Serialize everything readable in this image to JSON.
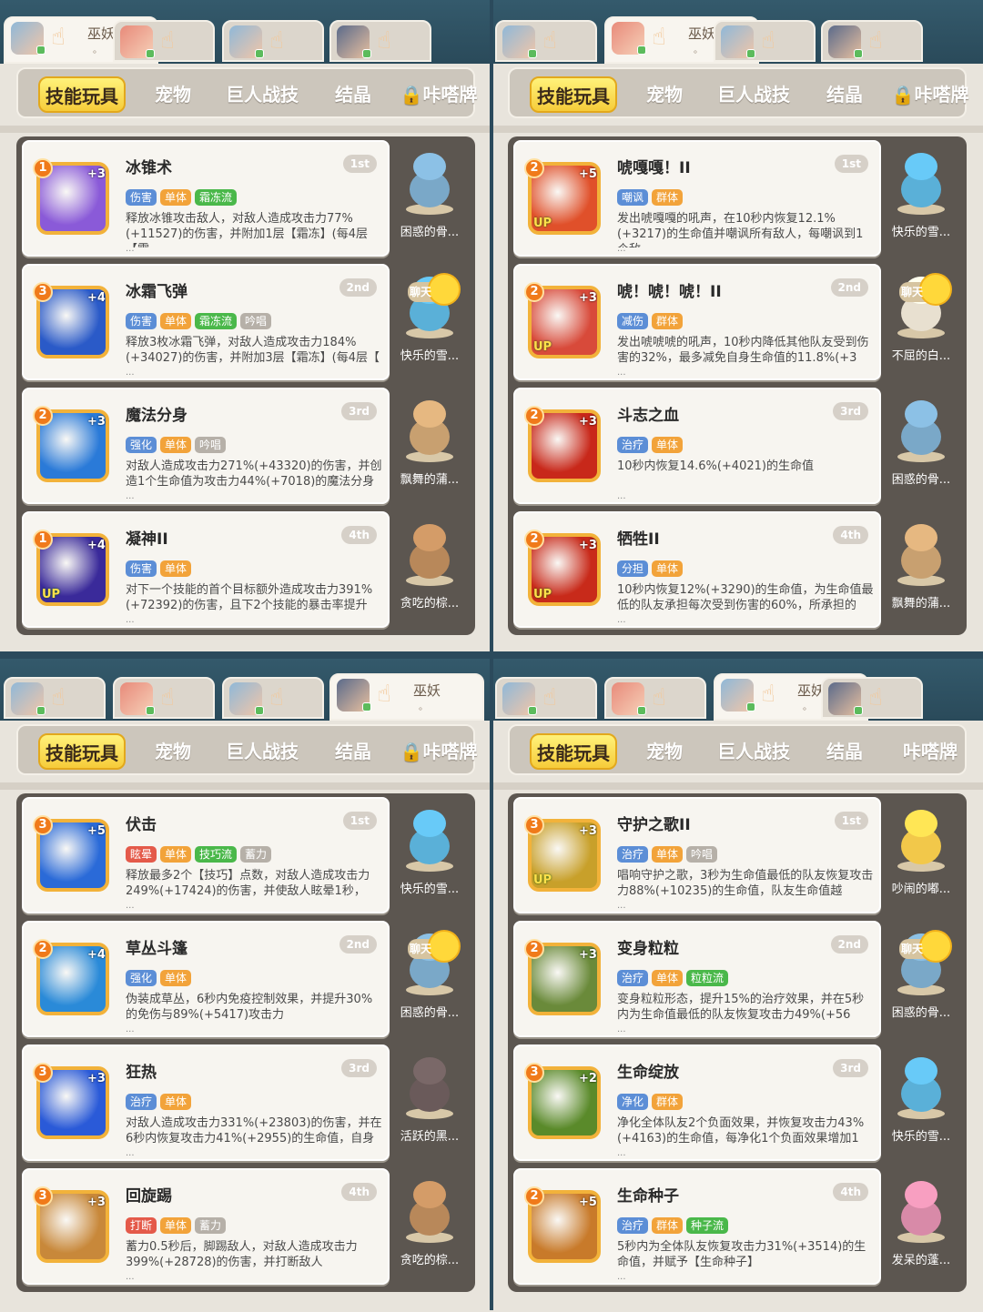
{
  "colors": {
    "tag_red": "#e45a4a",
    "tag_blue": "#5c8ed6",
    "tag_orange": "#f2a33a",
    "tag_green": "#4ab84a",
    "tag_gray": "#b6b0a8",
    "rank_bg": "#d6d0c8",
    "active_tab": "#f6cc3a"
  },
  "panels": [
    {
      "char_tabs": [
        {
          "name": "巫妖",
          "sub": "。",
          "active": true
        },
        {
          "name": "",
          "sub": "",
          "active": false
        },
        {
          "name": "",
          "sub": "",
          "active": false
        },
        {
          "name": "",
          "sub": "",
          "active": false
        }
      ],
      "tabs": [
        {
          "label": "技能玩具",
          "active": true
        },
        {
          "label": "宠物",
          "active": false
        },
        {
          "label": "巨人战技",
          "active": false
        },
        {
          "label": "结晶",
          "active": false
        },
        {
          "label": "🔒咔嗒牌",
          "active": false
        }
      ],
      "skills": [
        {
          "name": "冰锥术",
          "rank": "1st",
          "level": "1",
          "plus": "+3",
          "up": false,
          "icon_color": "#8a5ad8",
          "tags": [
            {
              "text": "伤害",
              "color": "blue"
            },
            {
              "text": "单体",
              "color": "orange"
            },
            {
              "text": "霜冻流",
              "color": "green"
            }
          ],
          "desc": "释放冰锥攻击敌人，对敌人造成攻击力77%(+11527)的伤害，并附加1层【霜冻】(每4层【霜",
          "pet": "困惑的骨...",
          "pet_color": "#7aa8c8",
          "chat": false
        },
        {
          "name": "冰霜飞弹",
          "rank": "2nd",
          "level": "3",
          "plus": "+4",
          "up": false,
          "icon_color": "#2a5ac8",
          "tags": [
            {
              "text": "伤害",
              "color": "blue"
            },
            {
              "text": "单体",
              "color": "orange"
            },
            {
              "text": "霜冻流",
              "color": "green"
            },
            {
              "text": "吟唱",
              "color": "gray"
            }
          ],
          "desc": "释放3枚冰霜飞弹，对敌人造成攻击力184%(+34027)的伤害，并附加3层【霜冻】(每4层【",
          "pet": "快乐的雪...",
          "pet_color": "#5ab0d8",
          "chat": true,
          "chat_label": "聊天"
        },
        {
          "name": "魔法分身",
          "rank": "3rd",
          "level": "2",
          "plus": "+3",
          "up": false,
          "icon_color": "#2a7ad8",
          "tags": [
            {
              "text": "强化",
              "color": "blue"
            },
            {
              "text": "单体",
              "color": "orange"
            },
            {
              "text": "吟唱",
              "color": "gray"
            }
          ],
          "desc": "对敌人造成攻击力271%(+43320)的伤害，并创造1个生命值为攻击力44%(+7018)的魔法分身",
          "pet": "飘舞的蒲...",
          "pet_color": "#c8a070",
          "chat": false
        },
        {
          "name": "凝神II",
          "rank": "4th",
          "level": "1",
          "plus": "+4",
          "up": true,
          "icon_color": "#3a2a9a",
          "tags": [
            {
              "text": "伤害",
              "color": "blue"
            },
            {
              "text": "单体",
              "color": "orange"
            }
          ],
          "desc": "对下一个技能的首个目标额外造成攻击力391%(+72392)的伤害，且下2个技能的暴击率提升",
          "pet": "贪吃的棕...",
          "pet_color": "#b8885a",
          "chat": false
        }
      ]
    },
    {
      "char_tabs": [
        {
          "name": "",
          "sub": "",
          "active": false
        },
        {
          "name": "巫妖",
          "sub": "。",
          "active": true
        },
        {
          "name": "",
          "sub": "",
          "active": false
        },
        {
          "name": "",
          "sub": "",
          "active": false
        }
      ],
      "tabs": [
        {
          "label": "技能玩具",
          "active": true
        },
        {
          "label": "宠物",
          "active": false
        },
        {
          "label": "巨人战技",
          "active": false
        },
        {
          "label": "结晶",
          "active": false
        },
        {
          "label": "🔒咔嗒牌",
          "active": false
        }
      ],
      "skills": [
        {
          "name": "唬嘎嘎！II",
          "rank": "1st",
          "level": "2",
          "plus": "+5",
          "up": true,
          "icon_color": "#e0502a",
          "tags": [
            {
              "text": "嘲讽",
              "color": "blue"
            },
            {
              "text": "群体",
              "color": "orange"
            }
          ],
          "desc": "发出唬嘎嘎的吼声，在10秒内恢复12.1%(+3217)的生命值并嘲讽所有敌人，每嘲讽到1个敌",
          "pet": "快乐的雪...",
          "pet_color": "#5ab0d8",
          "chat": false
        },
        {
          "name": "唬！唬！唬！II",
          "rank": "2nd",
          "level": "2",
          "plus": "+3",
          "up": true,
          "icon_color": "#d84a3a",
          "tags": [
            {
              "text": "减伤",
              "color": "blue"
            },
            {
              "text": "群体",
              "color": "orange"
            }
          ],
          "desc": "发出唬唬唬的吼声，10秒内降低其他队友受到伤害的32%，最多减免自身生命值的11.8%(+3",
          "pet": "不屈的白...",
          "pet_color": "#e8e0d0",
          "chat": true,
          "chat_label": "聊天"
        },
        {
          "name": "斗志之血",
          "rank": "3rd",
          "level": "2",
          "plus": "+3",
          "up": false,
          "icon_color": "#c8281a",
          "tags": [
            {
              "text": "治疗",
              "color": "blue"
            },
            {
              "text": "单体",
              "color": "orange"
            }
          ],
          "desc": "10秒内恢复14.6%(+4021)的生命值",
          "pet": "困惑的骨...",
          "pet_color": "#7aa8c8",
          "chat": false
        },
        {
          "name": "牺牲II",
          "rank": "4th",
          "level": "2",
          "plus": "+3",
          "up": true,
          "icon_color": "#c82a1a",
          "tags": [
            {
              "text": "分担",
              "color": "blue"
            },
            {
              "text": "单体",
              "color": "orange"
            }
          ],
          "desc": "10秒内恢复12%(+3290)的生命值，为生命值最低的队友承担每次受到伤害的60%，所承担的",
          "pet": "飘舞的蒲...",
          "pet_color": "#c8a070",
          "chat": false
        }
      ]
    },
    {
      "char_tabs": [
        {
          "name": "",
          "sub": "",
          "active": false
        },
        {
          "name": "",
          "sub": "",
          "active": false
        },
        {
          "name": "",
          "sub": "",
          "active": false
        },
        {
          "name": "巫妖",
          "sub": "。",
          "active": true
        }
      ],
      "tabs": [
        {
          "label": "技能玩具",
          "active": true
        },
        {
          "label": "宠物",
          "active": false
        },
        {
          "label": "巨人战技",
          "active": false
        },
        {
          "label": "结晶",
          "active": false
        },
        {
          "label": "🔒咔嗒牌",
          "active": false
        }
      ],
      "skills": [
        {
          "name": "伏击",
          "rank": "1st",
          "level": "3",
          "plus": "+5",
          "up": false,
          "icon_color": "#2a6ad8",
          "tags": [
            {
              "text": "眩晕",
              "color": "red"
            },
            {
              "text": "单体",
              "color": "orange"
            },
            {
              "text": "技巧流",
              "color": "green"
            },
            {
              "text": "蓄力",
              "color": "gray"
            }
          ],
          "desc": "释放最多2个【技巧】点数，对敌人造成攻击力249%(+17424)的伤害，并使敌人眩晕1秒，",
          "pet": "快乐的雪...",
          "pet_color": "#5ab0d8",
          "chat": false
        },
        {
          "name": "草丛斗篷",
          "rank": "2nd",
          "level": "2",
          "plus": "+4",
          "up": false,
          "icon_color": "#2a8ad8",
          "tags": [
            {
              "text": "强化",
              "color": "blue"
            },
            {
              "text": "单体",
              "color": "orange"
            }
          ],
          "desc": "伪装成草丛，6秒内免疫控制效果，并提升30%的免伤与89%(+5417)攻击力",
          "pet": "困惑的骨...",
          "pet_color": "#7aa8c8",
          "chat": true,
          "chat_label": "聊天"
        },
        {
          "name": "狂热",
          "rank": "3rd",
          "level": "3",
          "plus": "+3",
          "up": false,
          "icon_color": "#2a5ad8",
          "tags": [
            {
              "text": "治疗",
              "color": "blue"
            },
            {
              "text": "单体",
              "color": "orange"
            }
          ],
          "desc": "对敌人造成攻击力331%(+23803)的伤害，并在6秒内恢复攻击力41%(+2955)的生命值，自身",
          "pet": "活跃的黑...",
          "pet_color": "#6a5a5a",
          "chat": false
        },
        {
          "name": "回旋踢",
          "rank": "4th",
          "level": "3",
          "plus": "+3",
          "up": false,
          "icon_color": "#c8883a",
          "tags": [
            {
              "text": "打断",
              "color": "red"
            },
            {
              "text": "单体",
              "color": "orange"
            },
            {
              "text": "蓄力",
              "color": "gray"
            }
          ],
          "desc": "蓄力0.5秒后，脚踢敌人，对敌人造成攻击力399%(+28728)的伤害，并打断敌人",
          "pet": "贪吃的棕...",
          "pet_color": "#b8885a",
          "chat": false
        }
      ]
    },
    {
      "char_tabs": [
        {
          "name": "",
          "sub": "",
          "active": false
        },
        {
          "name": "",
          "sub": "",
          "active": false
        },
        {
          "name": "巫妖",
          "sub": "。",
          "active": true
        },
        {
          "name": "",
          "sub": "",
          "active": false
        }
      ],
      "tabs": [
        {
          "label": "技能玩具",
          "active": true
        },
        {
          "label": "宠物",
          "active": false
        },
        {
          "label": "巨人战技",
          "active": false
        },
        {
          "label": "结晶",
          "active": false
        },
        {
          "label": "咔嗒牌",
          "active": false
        }
      ],
      "skills": [
        {
          "name": "守护之歌II",
          "rank": "1st",
          "level": "3",
          "plus": "+3",
          "up": true,
          "icon_color": "#c8a02a",
          "tags": [
            {
              "text": "治疗",
              "color": "blue"
            },
            {
              "text": "单体",
              "color": "orange"
            },
            {
              "text": "吟唱",
              "color": "gray"
            }
          ],
          "desc": "唱响守护之歌，3秒为生命值最低的队友恢复攻击力88%(+10235)的生命值，队友生命值越",
          "pet": "吵闹的嘟...",
          "pet_color": "#f2c84a",
          "chat": false
        },
        {
          "name": "变身粒粒",
          "rank": "2nd",
          "level": "2",
          "plus": "+3",
          "up": false,
          "icon_color": "#6a8a3a",
          "tags": [
            {
              "text": "治疗",
              "color": "blue"
            },
            {
              "text": "单体",
              "color": "orange"
            },
            {
              "text": "粒粒流",
              "color": "green"
            }
          ],
          "desc": "变身粒粒形态，提升15%的治疗效果，并在5秒内为生命值最低的队友恢复攻击力49%(+56",
          "pet": "困惑的骨...",
          "pet_color": "#7aa8c8",
          "chat": true,
          "chat_label": "聊天"
        },
        {
          "name": "生命绽放",
          "rank": "3rd",
          "level": "3",
          "plus": "+2",
          "up": false,
          "icon_color": "#5a8a2a",
          "tags": [
            {
              "text": "净化",
              "color": "blue"
            },
            {
              "text": "群体",
              "color": "orange"
            }
          ],
          "desc": "净化全体队友2个负面效果，并恢复攻击力43%(+4163)的生命值，每净化1个负面效果增加1",
          "pet": "快乐的雪...",
          "pet_color": "#5ab0d8",
          "chat": false
        },
        {
          "name": "生命种子",
          "rank": "4th",
          "level": "2",
          "plus": "+5",
          "up": false,
          "icon_color": "#c87a2a",
          "tags": [
            {
              "text": "治疗",
              "color": "blue"
            },
            {
              "text": "群体",
              "color": "orange"
            },
            {
              "text": "种子流",
              "color": "green"
            }
          ],
          "desc": "5秒内为全体队友恢复攻击力31%(+3514)的生命值，并赋予【生命种子】",
          "pet": "发呆的蓬...",
          "pet_color": "#d88aa8",
          "chat": false
        }
      ]
    }
  ]
}
